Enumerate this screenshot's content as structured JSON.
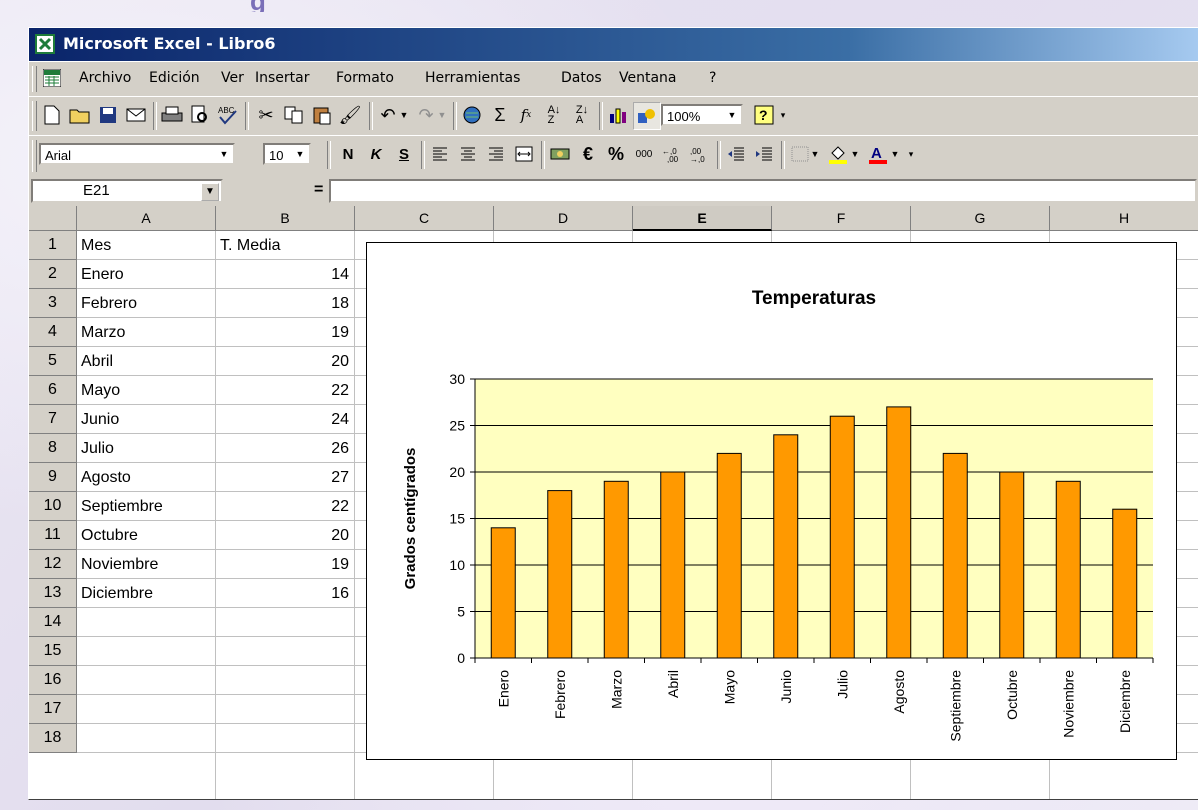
{
  "window": {
    "title": "Microsoft Excel - Libro6"
  },
  "slide_title_fragment": "g",
  "menu": [
    "Archivo",
    "Edición",
    "Ver",
    "Insertar",
    "Formato",
    "Herramientas",
    "Datos",
    "Ventana",
    "?"
  ],
  "toolbar1": {
    "zoom": "100%"
  },
  "toolbar2": {
    "font": "Arial",
    "size": "10",
    "bold": "N",
    "italic": "K",
    "underline": "S",
    "euro": "€",
    "percent": "%",
    "thousands": "000"
  },
  "formula": {
    "name_box": "E21",
    "equals": "=",
    "value": ""
  },
  "columns": [
    "A",
    "B",
    "C",
    "D",
    "E",
    "F",
    "G",
    "H"
  ],
  "active_column": "E",
  "rows": [
    "1",
    "2",
    "3",
    "4",
    "5",
    "6",
    "7",
    "8",
    "9",
    "10",
    "11",
    "12",
    "13",
    "14",
    "15",
    "16",
    "17",
    "18"
  ],
  "sheet": {
    "header": [
      "Mes",
      "T. Media"
    ],
    "data": [
      [
        "Enero",
        "14"
      ],
      [
        "Febrero",
        "18"
      ],
      [
        "Marzo",
        "19"
      ],
      [
        "Abril",
        "20"
      ],
      [
        "Mayo",
        "22"
      ],
      [
        "Junio",
        "24"
      ],
      [
        "Julio",
        "26"
      ],
      [
        "Agosto",
        "27"
      ],
      [
        "Septiembre",
        "22"
      ],
      [
        "Octubre",
        "20"
      ],
      [
        "Noviembre",
        "19"
      ],
      [
        "Diciembre",
        "16"
      ]
    ]
  },
  "chart_data": {
    "type": "bar",
    "title": "Temperaturas",
    "ylabel": "Grados centígrados",
    "xlabel": "",
    "categories": [
      "Enero",
      "Febrero",
      "Marzo",
      "Abril",
      "Mayo",
      "Junio",
      "Julio",
      "Agosto",
      "Septiembre",
      "Octubre",
      "Noviembre",
      "Diciembre"
    ],
    "values": [
      14,
      18,
      19,
      20,
      22,
      24,
      26,
      27,
      22,
      20,
      19,
      16
    ],
    "ylim": [
      0,
      30
    ],
    "yticks": [
      0,
      5,
      10,
      15,
      20,
      25,
      30
    ],
    "grid": true,
    "legend": "none",
    "bar_color": "#ff9900",
    "plot_bg": "#ffffc0"
  }
}
